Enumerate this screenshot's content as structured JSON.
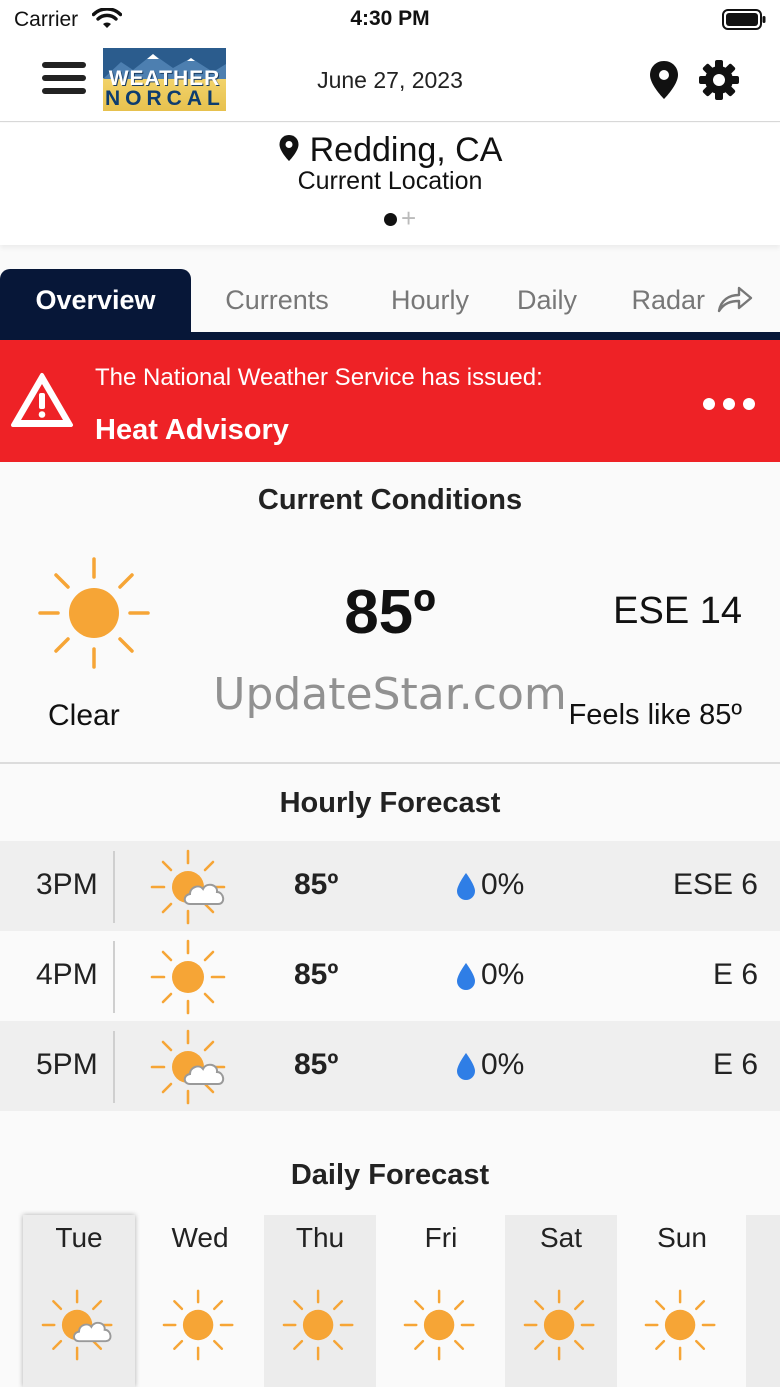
{
  "status_bar": {
    "carrier": "Carrier",
    "time": "4:30 PM"
  },
  "nav": {
    "logo_line1": "WEATHER",
    "logo_line2": "NORCAL",
    "date": "June 27, 2023"
  },
  "location": {
    "city": "Redding, CA",
    "subtitle": "Current Location",
    "add_symbol": "+"
  },
  "tabs": [
    {
      "label": "Overview",
      "active": true
    },
    {
      "label": "Currents",
      "active": false
    },
    {
      "label": "Hourly",
      "active": false
    },
    {
      "label": "Daily",
      "active": false
    },
    {
      "label": "Radar",
      "active": false
    }
  ],
  "alert": {
    "line1": "The National Weather Service has issued:",
    "line2": "Heat Advisory",
    "color": "#ee2226"
  },
  "current": {
    "title": "Current Conditions",
    "temp": "85º",
    "wind": "ESE 14",
    "condition": "Clear",
    "feels_like": "Feels like 85º",
    "icon": "sun-icon"
  },
  "watermark": "UpdateStar.com",
  "hourly": {
    "title": "Hourly Forecast",
    "rows": [
      {
        "time": "3PM",
        "icon": "partly-cloudy-icon",
        "temp": "85º",
        "precip": "0%",
        "wind": "ESE 6"
      },
      {
        "time": "4PM",
        "icon": "sun-icon",
        "temp": "85º",
        "precip": "0%",
        "wind": "E 6"
      },
      {
        "time": "5PM",
        "icon": "partly-cloudy-icon",
        "temp": "85º",
        "precip": "0%",
        "wind": "E 6"
      }
    ]
  },
  "daily": {
    "title": "Daily Forecast",
    "days": [
      {
        "name": "Tue",
        "icon": "partly-cloudy-icon"
      },
      {
        "name": "Wed",
        "icon": "sun-icon"
      },
      {
        "name": "Thu",
        "icon": "sun-icon"
      },
      {
        "name": "Fri",
        "icon": "sun-icon"
      },
      {
        "name": "Sat",
        "icon": "sun-icon"
      },
      {
        "name": "Sun",
        "icon": "sun-icon"
      }
    ]
  },
  "colors": {
    "navy": "#071738",
    "alert_red": "#ee2226",
    "sun_orange": "#f6a536",
    "drop_blue": "#2f7ee6"
  }
}
